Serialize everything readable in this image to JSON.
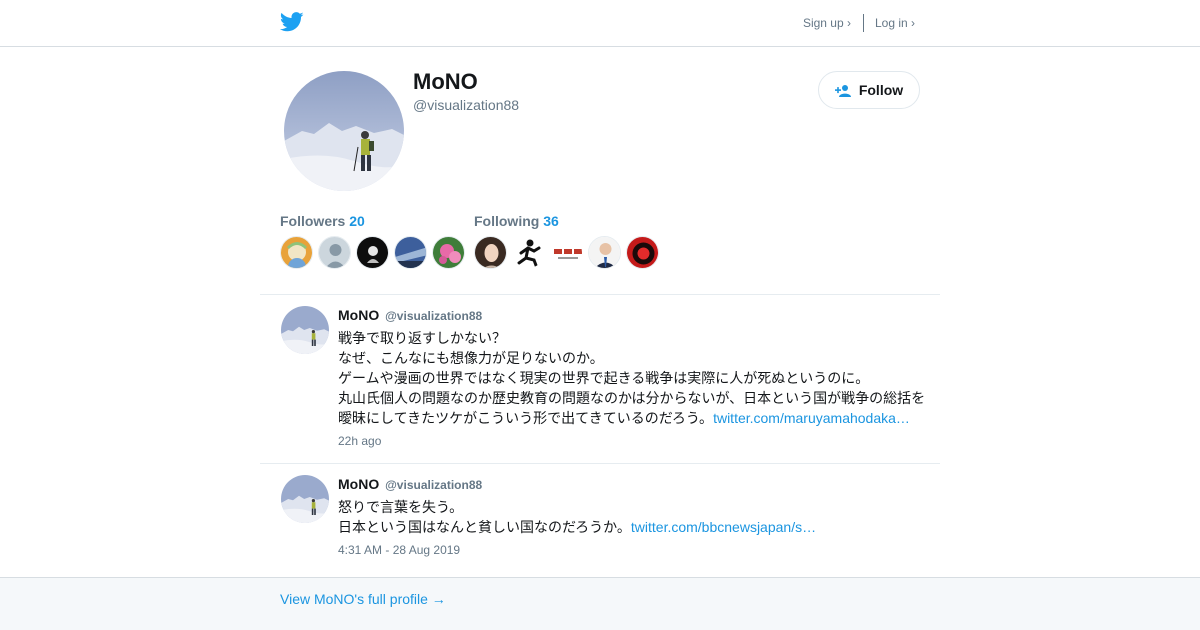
{
  "header": {
    "signup_label": "Sign up ›",
    "login_label": "Log in ›"
  },
  "profile": {
    "name": "MoNO",
    "handle": "@visualization88",
    "follow_label": "Follow",
    "followers": {
      "label": "Followers",
      "count": "20"
    },
    "following": {
      "label": "Following",
      "count": "36"
    }
  },
  "tweets": [
    {
      "name": "MoNO",
      "handle": "@visualization88",
      "lines": [
        "戦争で取り返すしかない？",
        "なぜ、こんなにも想像力が足りないのか。",
        "ゲームや漫画の世界ではなく現実の世界で起きる戦争は実際に人が死ぬというのに。",
        "丸山氏個人の問題なのか歴史教育の問題なのかは分からないが、日本という国が戦争の総括を",
        "曖昧にしてきたツケがこういう形で出てきているのだろう。"
      ],
      "link": "twitter.com/maruyamahodaka…",
      "time": "22h ago"
    },
    {
      "name": "MoNO",
      "handle": "@visualization88",
      "lines": [
        "怒りで言葉を失う。",
        "日本という国はなんと貧しい国なのだろうか。"
      ],
      "link": "twitter.com/bbcnewsjapan/s…",
      "time": "4:31 AM - 28 Aug 2019"
    }
  ],
  "footer": {
    "link_label": "View MoNO's full profile →"
  },
  "colors": {
    "accent": "#1b95e0",
    "twitter_blue": "#1da1f2",
    "muted": "#657786",
    "footer_bg": "#f5f8fa"
  },
  "icons": [
    "twitter-bird-icon",
    "add-person-icon"
  ]
}
